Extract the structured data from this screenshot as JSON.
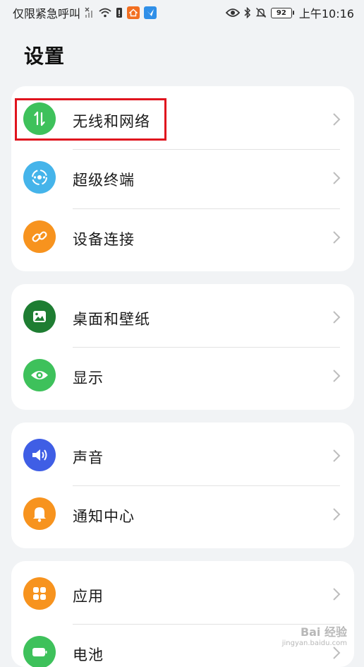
{
  "status_bar": {
    "carrier": "仅限紧急呼叫",
    "battery": "92",
    "time": "上午10:16"
  },
  "page": {
    "title": "设置"
  },
  "groups": [
    {
      "items": [
        {
          "label": "无线和网络",
          "icon": "wireless-network-icon",
          "color": "#3ec15b"
        },
        {
          "label": "超级终端",
          "icon": "super-device-icon",
          "color": "#45b4ea"
        },
        {
          "label": "设备连接",
          "icon": "link-icon",
          "color": "#f7931e"
        }
      ]
    },
    {
      "items": [
        {
          "label": "桌面和壁纸",
          "icon": "wallpaper-icon",
          "color": "#1e7d32"
        },
        {
          "label": "显示",
          "icon": "eye-icon",
          "color": "#3ec15b"
        }
      ]
    },
    {
      "items": [
        {
          "label": "声音",
          "icon": "speaker-icon",
          "color": "#3f5ee5"
        },
        {
          "label": "通知中心",
          "icon": "bell-icon",
          "color": "#f7931e"
        }
      ]
    },
    {
      "items": [
        {
          "label": "应用",
          "icon": "apps-icon",
          "color": "#f7931e"
        },
        {
          "label": "电池",
          "icon": "battery-icon",
          "color": "#3ec15b"
        }
      ]
    }
  ],
  "watermark": {
    "main": "Bai 经验",
    "sub": "jingyan.baidu.com"
  }
}
